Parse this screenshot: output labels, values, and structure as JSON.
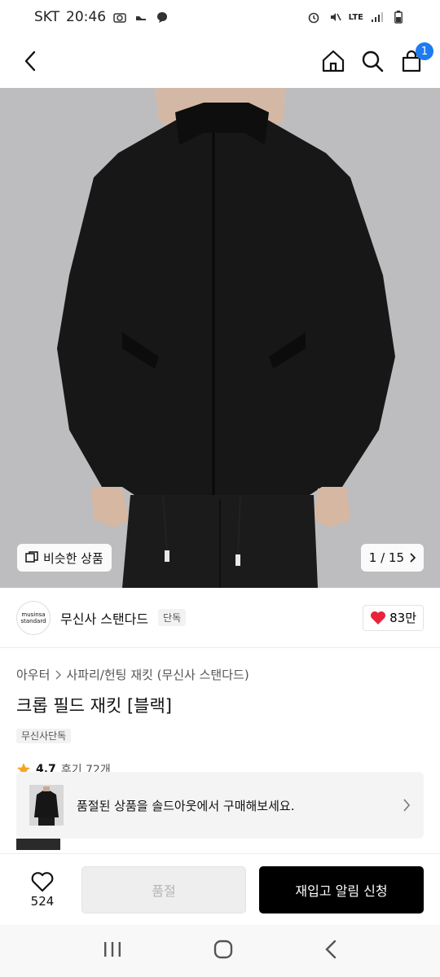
{
  "status_bar": {
    "carrier": "SKT",
    "time": "20:46",
    "network": "LTE"
  },
  "nav": {
    "cart_count": "1"
  },
  "hero": {
    "similar_label": "비슷한 상품",
    "pager": "1 / 15"
  },
  "brand": {
    "logo_line1": "musinsa",
    "logo_line2": "standard",
    "name": "무신사 스탠다드",
    "tag": "단독",
    "likes": "83만"
  },
  "product": {
    "breadcrumb_category": "아우터",
    "breadcrumb_sub": "사파리/헌팅 재킷 (무신사 스탠다드)",
    "title": "크롭 필드 재킷 [블랙]",
    "exclusive_tag": "무신사단독",
    "rating": "4.7",
    "reviews": "후기 72개"
  },
  "soldout_notice": {
    "text": "품절된 상품을 솔드아웃에서 구매해보세요."
  },
  "bottom": {
    "like_count": "524",
    "soldout_label": "품절",
    "restock_label": "재입고 알림 신청"
  },
  "colors": {
    "accent_blue": "#1e7bf0",
    "heart_red": "#e8233b",
    "star_orange": "#f5a623"
  }
}
